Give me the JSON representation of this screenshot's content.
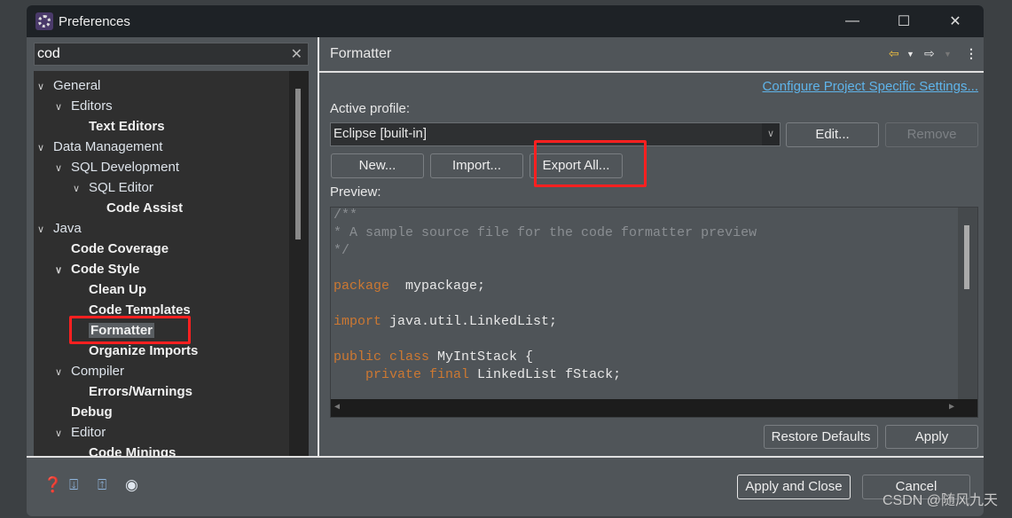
{
  "window": {
    "title": "Preferences",
    "minimize": "—",
    "maximize": "☐",
    "close": "✕"
  },
  "search": {
    "value": "cod",
    "clear": "✕"
  },
  "tree": [
    {
      "label": "General",
      "level": 0,
      "expanded": true,
      "bold": false
    },
    {
      "label": "Editors",
      "level": 1,
      "expanded": true,
      "bold": false
    },
    {
      "label": "Text Editors",
      "level": 2,
      "bold": true
    },
    {
      "label": "Data Management",
      "level": 0,
      "expanded": true,
      "bold": false
    },
    {
      "label": "SQL Development",
      "level": 1,
      "expanded": true,
      "bold": false
    },
    {
      "label": "SQL Editor",
      "level": 2,
      "expanded": true,
      "bold": false
    },
    {
      "label": "Code Assist",
      "level": 3,
      "bold": true
    },
    {
      "label": "Java",
      "level": 0,
      "expanded": true,
      "bold": false
    },
    {
      "label": "Code Coverage",
      "level": 1,
      "bold": true
    },
    {
      "label": "Code Style",
      "level": 1,
      "expanded": true,
      "bold": true
    },
    {
      "label": "Clean Up",
      "level": 2,
      "bold": true
    },
    {
      "label": "Code Templates",
      "level": 2,
      "bold": true
    },
    {
      "label": "Formatter",
      "level": 2,
      "bold": true,
      "selected": true
    },
    {
      "label": "Organize Imports",
      "level": 2,
      "bold": true
    },
    {
      "label": "Compiler",
      "level": 1,
      "expanded": true,
      "bold": false
    },
    {
      "label": "Errors/Warnings",
      "level": 2,
      "bold": true
    },
    {
      "label": "Debug",
      "level": 1,
      "bold": true
    },
    {
      "label": "Editor",
      "level": 1,
      "expanded": true,
      "bold": false
    },
    {
      "label": "Code Minings",
      "level": 2,
      "bold": true
    }
  ],
  "page": {
    "title": "Formatter",
    "configure_link": "Configure Project Specific Settings...",
    "active_profile_label": "Active profile:",
    "profile_value": "Eclipse [built-in]",
    "edit": "Edit...",
    "remove": "Remove",
    "new": "New...",
    "import": "Import...",
    "export_all": "Export All...",
    "preview_label": "Preview:",
    "restore_defaults": "Restore Defaults",
    "apply": "Apply"
  },
  "code": [
    [
      [
        "cm",
        "/**"
      ]
    ],
    [
      [
        "cm",
        "* A sample source file for the code formatter preview"
      ]
    ],
    [
      [
        "cm",
        "*/"
      ]
    ],
    [],
    [
      [
        "kw",
        "package"
      ],
      [
        "",
        "  mypackage;"
      ]
    ],
    [],
    [
      [
        "kw",
        "import"
      ],
      [
        "",
        " java.util.LinkedList;"
      ]
    ],
    [],
    [
      [
        "kw",
        "public class"
      ],
      [
        "",
        " MyIntStack {"
      ]
    ],
    [
      [
        "",
        "    "
      ],
      [
        "kw",
        "private final"
      ],
      [
        "",
        " LinkedList fStack;"
      ]
    ]
  ],
  "footer": {
    "apply_and_close": "Apply and Close",
    "cancel": "Cancel",
    "icons": [
      "help-icon",
      "import-icon",
      "export-icon",
      "oomph-icon"
    ]
  },
  "watermark": "CSDN @随风九天",
  "colors": {
    "highlight_box": "#ff2020",
    "link": "#5fb4ea",
    "keyword": "#cc7832",
    "comment": "#8a8e92"
  }
}
